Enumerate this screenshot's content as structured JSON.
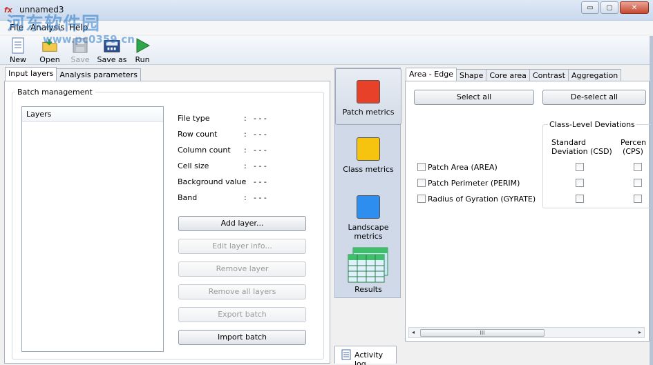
{
  "window": {
    "title": "unnamed3",
    "app_icon_text": "fx",
    "controls": {
      "minimize": "▭",
      "maximize": "▢",
      "close": "✕"
    }
  },
  "watermark": {
    "text": "河东软件园",
    "url": "www.pc0359.cn"
  },
  "menu": {
    "items": [
      "File",
      "Analysis",
      "Help"
    ]
  },
  "toolbar": {
    "buttons": [
      {
        "label": "New",
        "icon": "new-document-icon",
        "enabled": true
      },
      {
        "label": "Open",
        "icon": "open-folder-icon",
        "enabled": true
      },
      {
        "label": "Save",
        "icon": "save-disk-icon",
        "enabled": false
      },
      {
        "label": "Save as",
        "icon": "save-as-icon",
        "enabled": true
      },
      {
        "label": "Run",
        "icon": "run-arrow-icon",
        "enabled": true
      }
    ]
  },
  "left_tabs": [
    {
      "label": "Input layers",
      "active": true
    },
    {
      "label": "Analysis parameters",
      "active": false
    }
  ],
  "batch": {
    "group_label": "Batch management",
    "list_header": "Layers",
    "info": [
      {
        "key": "File type",
        "value": "- - -"
      },
      {
        "key": "Row count",
        "value": "- - -"
      },
      {
        "key": "Column count",
        "value": "- - -"
      },
      {
        "key": "Cell size",
        "value": "- - -"
      },
      {
        "key": "Background value",
        "value": "- - -"
      },
      {
        "key": "Band",
        "value": "- - -"
      }
    ],
    "buttons": [
      {
        "label": "Add layer...",
        "enabled": true
      },
      {
        "label": "Edit layer info...",
        "enabled": false
      },
      {
        "label": "Remove layer",
        "enabled": false
      },
      {
        "label": "Remove all layers",
        "enabled": false
      },
      {
        "label": "Export batch",
        "enabled": false
      },
      {
        "label": "Import batch",
        "enabled": true
      }
    ]
  },
  "metrics_nav": [
    {
      "label": "Patch metrics",
      "color": "#e8412a",
      "active": true
    },
    {
      "label": "Class metrics",
      "color": "#f6c40f",
      "active": false
    },
    {
      "label": "Landscape metrics",
      "color": "#2e8ef0",
      "active": false
    },
    {
      "label": "Results",
      "color": "#3fbf6a",
      "active": false
    }
  ],
  "right_tabs": [
    {
      "label": "Area - Edge",
      "active": true
    },
    {
      "label": "Shape",
      "active": false
    },
    {
      "label": "Core area",
      "active": false
    },
    {
      "label": "Contrast",
      "active": false
    },
    {
      "label": "Aggregation",
      "active": false
    }
  ],
  "metrics_panel": {
    "select_all": "Select all",
    "deselect_all": "De-select all",
    "deviations_label": "Class-Level Deviations",
    "col_csd_line1": "Standard",
    "col_csd_line2": "Deviation  (CSD)",
    "col_cps_line1": "Percen",
    "col_cps_line2": "(CPS)",
    "rows": [
      {
        "label": "Patch Area  (AREA)",
        "checked": false
      },
      {
        "label": "Patch Perimeter  (PERIM)",
        "checked": false
      },
      {
        "label": "Radius of Gyration  (GYRATE)",
        "checked": false
      }
    ],
    "scroll_thumb_text": "III",
    "scroll_left": "◂",
    "scroll_right": "▸"
  },
  "activity_log": {
    "label": "Activity log"
  }
}
